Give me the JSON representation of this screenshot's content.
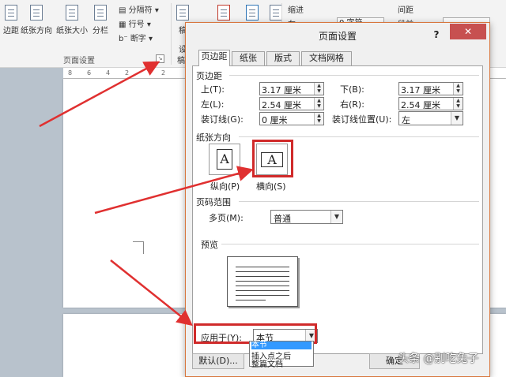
{
  "ribbon": {
    "buttons": {
      "margins": "边距",
      "orientation": "纸张方向",
      "size": "纸张大小",
      "columns": "分栏"
    },
    "small": {
      "breaks": "分隔符",
      "line_numbers": "行号",
      "hyphenation": "断字"
    },
    "group_label": "页面设置",
    "next_group_fragment": "稿",
    "next_group_fragment2": "设",
    "next_group_label_fragment": "稿",
    "indent_label": "缩进",
    "spacing_label": "间距",
    "left_fragment": "左",
    "before_fragment": "段前",
    "indent_value": "0 字符"
  },
  "ruler": {
    "ticks": [
      "8",
      "6",
      "4",
      "2",
      "2"
    ]
  },
  "dialog": {
    "title": "页面设置",
    "help": "?",
    "close": "✕",
    "tabs": [
      "页边距",
      "纸张",
      "版式",
      "文档网格"
    ],
    "margins_section": {
      "title": "页边距",
      "top_label": "上(T):",
      "top_value": "3.17 厘米",
      "bottom_label": "下(B):",
      "bottom_value": "3.17 厘米",
      "left_label": "左(L):",
      "left_value": "2.54 厘米",
      "right_label": "右(R):",
      "right_value": "2.54 厘米",
      "gutter_label": "装订线(G):",
      "gutter_value": "0 厘米",
      "gutter_pos_label": "装订线位置(U):",
      "gutter_pos_value": "左"
    },
    "orientation_section": {
      "title": "纸张方向",
      "portrait_label": "纵向(P)",
      "landscape_label": "横向(S)",
      "glyph": "A"
    },
    "pages_section": {
      "title": "页码范围",
      "multiple_label": "多页(M):",
      "multiple_value": "普通"
    },
    "preview_section": {
      "title": "预览"
    },
    "apply_to": {
      "label": "应用于(Y):",
      "value": "本节",
      "options": [
        "本节",
        "插入点之后",
        "整篇文档"
      ]
    },
    "default_button": "默认(D)...",
    "ok_button": "确定"
  },
  "watermark": "头条 @别吃兔子",
  "colors": {
    "highlight_box": "#d02a2a",
    "arrow": "#e03030",
    "close_button": "#c75050",
    "selection": "#3399ff"
  }
}
